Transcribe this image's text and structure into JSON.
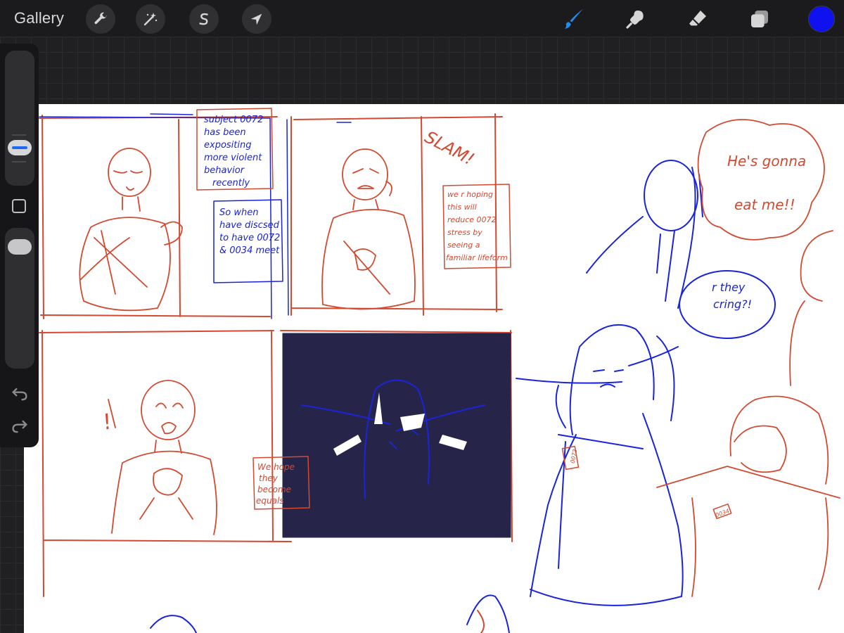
{
  "toolbar": {
    "gallery_label": "Gallery",
    "left_tools": [
      "wrench-icon",
      "magic-wand-icon",
      "selection-s-icon",
      "move-arrow-icon"
    ],
    "right_tools": [
      "brush-icon",
      "smudge-icon",
      "eraser-icon",
      "layers-icon"
    ],
    "active_tool": "brush-icon",
    "active_color": "#0f12ee",
    "accent_color": "#1e8cf0"
  },
  "sidebar": {
    "controls": [
      "brush-size-slider",
      "modify-button",
      "opacity-slider",
      "undo-button",
      "redo-button"
    ]
  },
  "canvas": {
    "ink_colors": {
      "red": "#d24a32",
      "blue": "#1a24d8",
      "panel_fill": "#262449"
    },
    "notes": {
      "note1": [
        "subject 0072",
        "has been",
        "expositing",
        "more violent",
        "behavior",
        "recently"
      ],
      "note2": [
        "So when",
        "have discsed",
        "to have 0072",
        "& 0034 meet"
      ],
      "note3": [
        "we r hoping",
        "this will",
        "reduce 0072",
        "stress by",
        "seeing a",
        "familiar lifeform"
      ],
      "note4": [
        "We hope",
        "they",
        "become",
        "equals"
      ]
    },
    "sfx": "SLAM!",
    "exclaim": "!",
    "speech1": [
      "He's gonna",
      "eat me!!"
    ],
    "speech2": [
      "r they",
      "cring?!"
    ],
    "tag1": "0072",
    "tag2": "0034"
  }
}
